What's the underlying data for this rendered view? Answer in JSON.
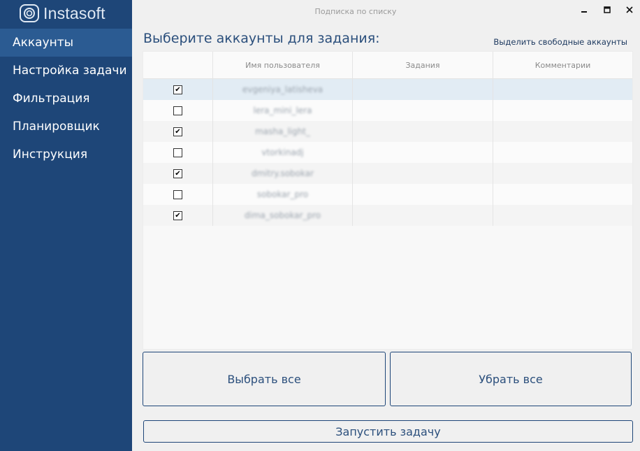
{
  "app": {
    "logo_text": "Instasoft",
    "window_title": "Подписка по списку"
  },
  "window_controls": {
    "minimize": "🗕",
    "maximize": "🗖",
    "close": "✕"
  },
  "sidebar": {
    "items": [
      {
        "label": "Аккаунты",
        "active": true
      },
      {
        "label": "Настройка задачи"
      },
      {
        "label": "Фильтрация"
      },
      {
        "label": "Планировщик"
      },
      {
        "label": "Инструкция"
      }
    ]
  },
  "main": {
    "heading": "Выберите аккаунты для задания:",
    "free_accounts_link": "Выделить свободные аккаунты",
    "table": {
      "headers": [
        "",
        "Имя пользователя",
        "Задания",
        "Комментарии"
      ],
      "rows": [
        {
          "checked": true,
          "username": "evgeniya_latisheva",
          "tasks": "",
          "comments": ""
        },
        {
          "checked": false,
          "username": "lera_mini_lera",
          "tasks": "",
          "comments": ""
        },
        {
          "checked": true,
          "username": "masha_light_",
          "tasks": "",
          "comments": ""
        },
        {
          "checked": false,
          "username": "vtorkinadj",
          "tasks": "",
          "comments": ""
        },
        {
          "checked": true,
          "username": "dmitry.sobokar",
          "tasks": "",
          "comments": ""
        },
        {
          "checked": false,
          "username": "sobokar_pro",
          "tasks": "",
          "comments": ""
        },
        {
          "checked": true,
          "username": "dima_sobokar_pro",
          "tasks": "",
          "comments": ""
        }
      ]
    },
    "select_all_label": "Выбрать все",
    "clear_all_label": "Убрать все",
    "start_label": "Запустить задачу"
  },
  "colors": {
    "sidebar": "#1e4678",
    "active_item": "#2b5b92",
    "accent_text": "#2b4f7c",
    "selected_row": "#e2ecf4"
  }
}
